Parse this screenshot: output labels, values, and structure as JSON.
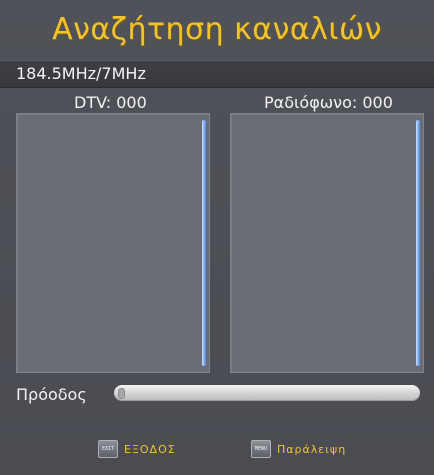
{
  "title": "Αναζήτηση καναλιών",
  "frequency": "184.5MHz/7MHz",
  "dtv_label": "DTV: 000",
  "radio_label": "Ραδιόφωνο: 000",
  "progress": {
    "label": "Πρόοδος",
    "percent": 0
  },
  "footer": {
    "exit_key": "EXIT",
    "exit_label": "ΕΞΟΔΟΣ",
    "menu_key": "MENU",
    "menu_label": "Παράλειψη"
  },
  "colors": {
    "title": "#f0c430",
    "panel": "#6b6d74",
    "scrollbar": "#7aa8ee",
    "background": "#4a4c52"
  }
}
